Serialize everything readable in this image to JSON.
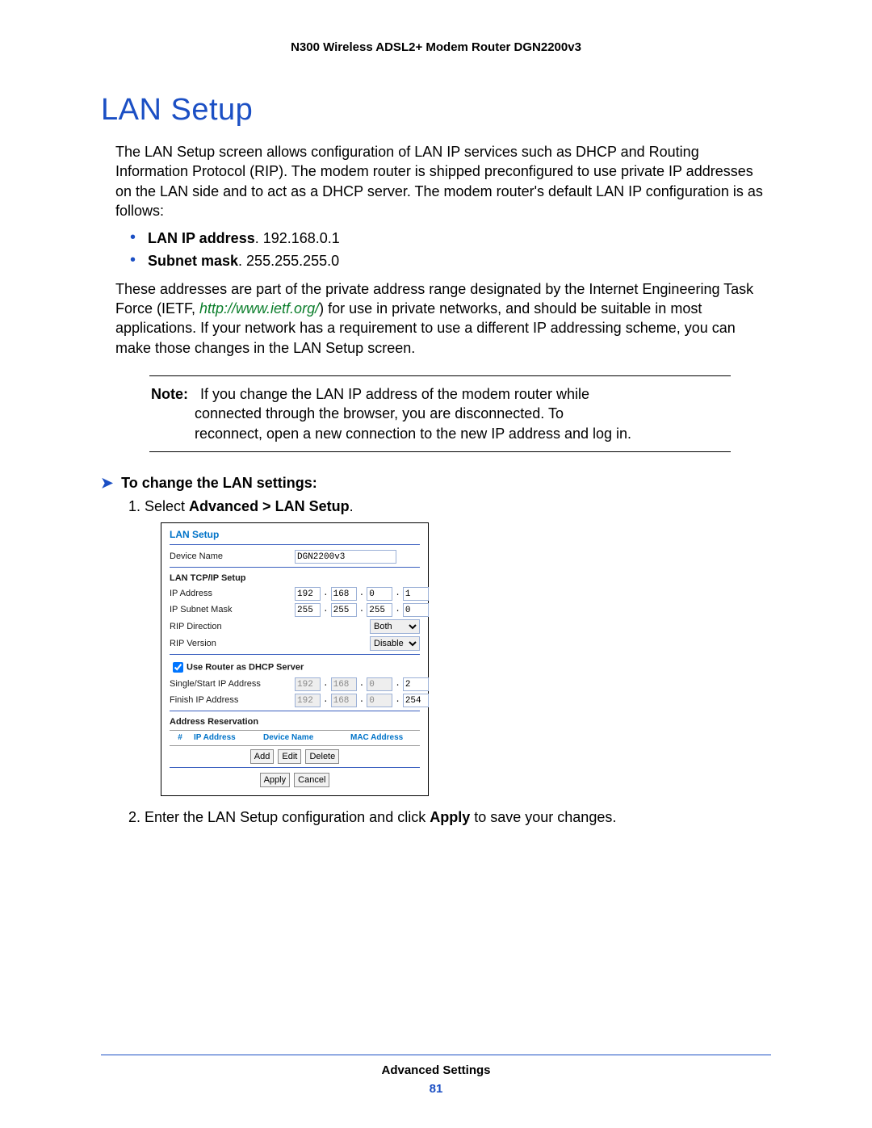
{
  "header": {
    "title": "N300 Wireless ADSL2+ Modem Router DGN2200v3"
  },
  "section": {
    "title": "LAN Setup"
  },
  "intro": "The LAN Setup screen allows configuration of LAN IP services such as DHCP and Routing Information Protocol (RIP). The modem router is shipped preconfigured to use private IP addresses on the LAN side and to act as a DHCP server. The modem router's default LAN IP configuration is as follows:",
  "defaults": {
    "lan_ip_label": "LAN IP address",
    "lan_ip_value": ". 192.168.0.1",
    "subnet_label": "Subnet mask",
    "subnet_value": ". 255.255.255.0"
  },
  "para2_pre": "These addresses are part of the private address range designated by the Internet Engineering Task Force (IETF, ",
  "para2_link": "http://www.ietf.org/",
  "para2_post": ") for use in private networks, and should be suitable in most applications. If your network has a requirement to use a different IP addressing scheme, you can make those changes in the LAN Setup screen.",
  "note": {
    "label": "Note:",
    "line1": "If you change the LAN IP address of the modem router while",
    "line2": "connected through the browser, you are disconnected. To",
    "line3": "reconnect, open a new connection to the new IP address and log in."
  },
  "procedure": {
    "heading": "To change the LAN settings:",
    "step1_pre": "Select ",
    "step1_bold": "Advanced > LAN Setup",
    "step1_post": ".",
    "step2_pre": "Enter the LAN Setup configuration and click ",
    "step2_bold": "Apply",
    "step2_post": " to save your changes."
  },
  "panel": {
    "title": "LAN Setup",
    "device_name_label": "Device Name",
    "device_name_value": "DGN2200v3",
    "tcpip_heading": "LAN TCP/IP Setup",
    "ip_address_label": "IP Address",
    "ip_address": {
      "o1": "192",
      "o2": "168",
      "o3": "0",
      "o4": "1"
    },
    "subnet_label": "IP Subnet Mask",
    "subnet": {
      "o1": "255",
      "o2": "255",
      "o3": "255",
      "o4": "0"
    },
    "rip_dir_label": "RIP Direction",
    "rip_dir_value": "Both",
    "rip_ver_label": "RIP Version",
    "rip_ver_value": "Disable",
    "dhcp_checkbox_label": "Use Router as DHCP Server",
    "start_ip_label": "Single/Start IP Address",
    "start_ip": {
      "o1": "192",
      "o2": "168",
      "o3": "0",
      "o4": "2"
    },
    "finish_ip_label": "Finish IP Address",
    "finish_ip": {
      "o1": "192",
      "o2": "168",
      "o3": "0",
      "o4": "254"
    },
    "ar_heading": "Address Reservation",
    "ar_cols": {
      "c1": "#",
      "c2": "IP Address",
      "c3": "Device Name",
      "c4": "MAC Address"
    },
    "buttons": {
      "add": "Add",
      "edit": "Edit",
      "del": "Delete",
      "apply": "Apply",
      "cancel": "Cancel"
    }
  },
  "footer": {
    "section": "Advanced Settings",
    "page": "81"
  }
}
